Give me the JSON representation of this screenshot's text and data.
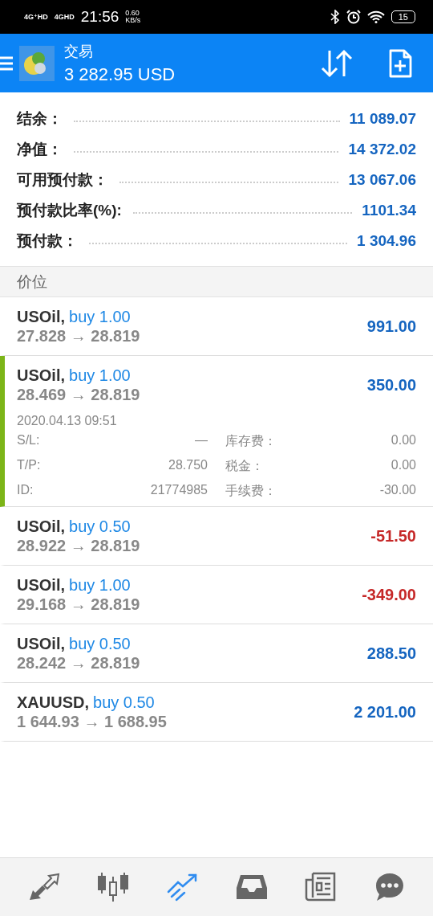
{
  "status_bar": {
    "signal_1": "4G⁺HD",
    "signal_2": "4GHD",
    "time": "21:56",
    "speed": "0.60",
    "speed_unit": "KB/s",
    "battery": "15"
  },
  "header": {
    "title": "交易",
    "balance": "3 282.95 USD"
  },
  "summary": [
    {
      "label": "结余：",
      "value": "11 089.07"
    },
    {
      "label": "净值：",
      "value": "14 372.02"
    },
    {
      "label": "可用预付款：",
      "value": "13 067.06"
    },
    {
      "label": "预付款比率(%):",
      "value": "1101.34"
    },
    {
      "label": "预付款：",
      "value": "1 304.96"
    }
  ],
  "section_title": "价位",
  "positions": [
    {
      "symbol": "USOil,",
      "side": "buy 1.00",
      "prices": "27.828 → 28.819",
      "profit": "991.00",
      "color": "#1565c0",
      "selected": false
    },
    {
      "symbol": "USOil,",
      "side": "buy 1.00",
      "prices": "28.469 → 28.819",
      "profit": "350.00",
      "color": "#1565c0",
      "selected": true,
      "details": {
        "time": "2020.04.13 09:51",
        "fields": [
          {
            "label": "S/L:",
            "value": "—",
            "label_2": "库存费：",
            "value_2": "0.00"
          },
          {
            "label": "T/P:",
            "value": "28.750",
            "label_2": "税金：",
            "value_2": "0.00"
          },
          {
            "label": "ID:",
            "value": "21774985",
            "label_2": "手续费：",
            "value_2": "-30.00"
          }
        ]
      }
    },
    {
      "symbol": "USOil,",
      "side": "buy 0.50",
      "prices": "28.922 → 28.819",
      "profit": "-51.50",
      "color": "#c62828",
      "selected": false
    },
    {
      "symbol": "USOil,",
      "side": "buy 1.00",
      "prices": "29.168 → 28.819",
      "profit": "-349.00",
      "color": "#c62828",
      "selected": false
    },
    {
      "symbol": "USOil,",
      "side": "buy 0.50",
      "prices": "28.242 → 28.819",
      "profit": "288.50",
      "color": "#1565c0",
      "selected": false
    },
    {
      "symbol": "XAUUSD,",
      "side": "buy 0.50",
      "prices": "1 644.93 → 1 688.95",
      "profit": "2 201.00",
      "color": "#1565c0",
      "selected": false
    }
  ],
  "bottom_nav": [
    {
      "selected": false
    },
    {
      "selected": false
    },
    {
      "selected": true
    },
    {
      "selected": false
    },
    {
      "selected": false
    },
    {
      "selected": false
    }
  ]
}
